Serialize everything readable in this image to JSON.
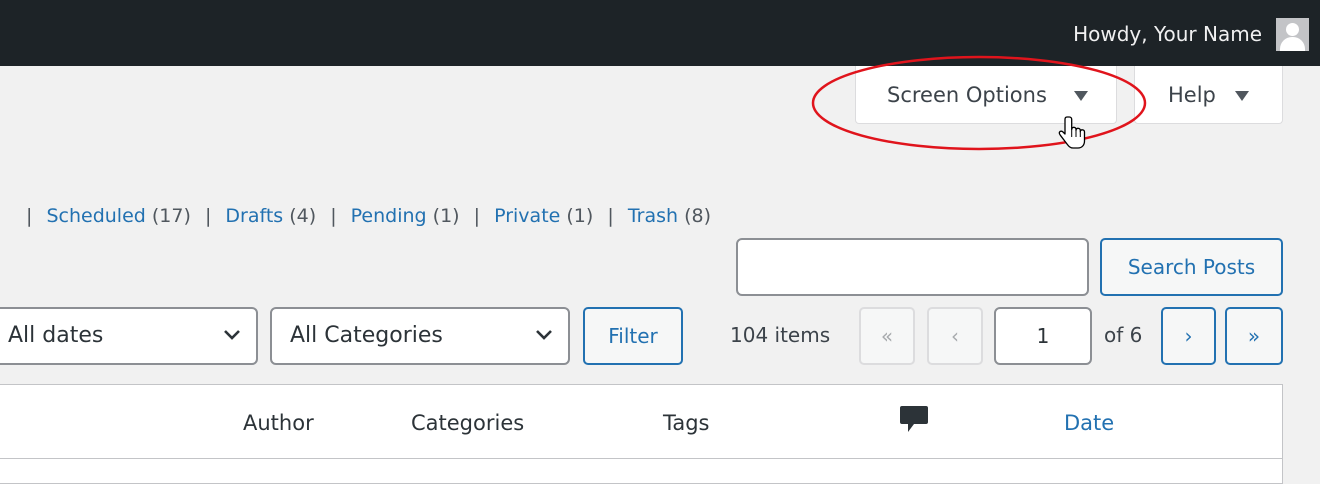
{
  "admin_bar": {
    "howdy": "Howdy, Your Name"
  },
  "screen_meta": {
    "screen_options": "Screen Options",
    "help": "Help"
  },
  "status_links": [
    {
      "label": "Scheduled",
      "count": "(17)"
    },
    {
      "label": "Drafts",
      "count": "(4)"
    },
    {
      "label": "Pending",
      "count": "(1)"
    },
    {
      "label": "Private",
      "count": "(1)"
    },
    {
      "label": "Trash",
      "count": "(8)"
    }
  ],
  "search": {
    "value": "",
    "button": "Search Posts"
  },
  "filters": {
    "dates": "All dates",
    "categories": "All Categories",
    "filter_button": "Filter"
  },
  "pagination": {
    "items": "104 items",
    "first": "«",
    "prev": "‹",
    "current": "1",
    "of": "of 6",
    "next": "›",
    "last": "»"
  },
  "table": {
    "columns": {
      "author": "Author",
      "categories": "Categories",
      "tags": "Tags",
      "date": "Date"
    }
  },
  "colors": {
    "admin_bar": "#1d2327",
    "link": "#2271b1",
    "annotation": "#e0141c",
    "background": "#f1f1f1"
  },
  "icons": {
    "avatar": "avatar-icon",
    "comments": "comment-bubble-icon",
    "cursor": "hand-pointer-icon"
  }
}
